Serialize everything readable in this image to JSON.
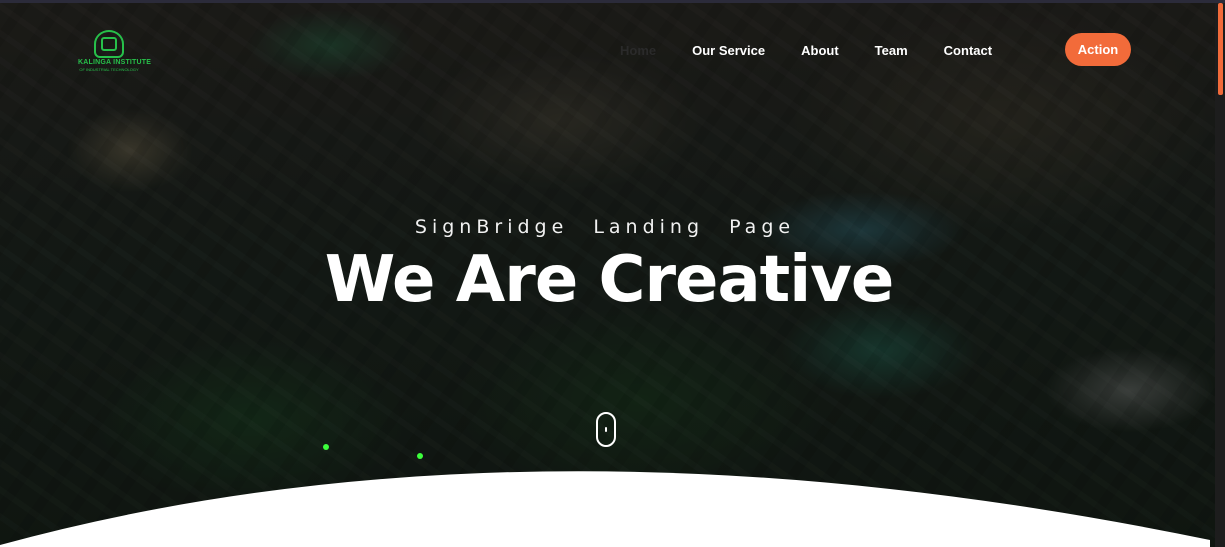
{
  "brand": {
    "logo_title": "KALINGA INSTITUTE",
    "logo_subtitle": "OF INDUSTRIAL TECHNOLOGY",
    "logo_color": "#27c04a"
  },
  "nav": {
    "items": [
      {
        "label": "Home"
      },
      {
        "label": "Our Service"
      },
      {
        "label": "About"
      },
      {
        "label": "Team"
      },
      {
        "label": "Contact"
      }
    ],
    "action_label": "Action",
    "accent_color": "#f26b3a"
  },
  "hero": {
    "subtitle": "SignBridge Landing Page",
    "headline": "We Are Creative"
  },
  "icons": {
    "scroll": "mouse-scroll-icon",
    "logo": "kiit-logo-icon"
  }
}
